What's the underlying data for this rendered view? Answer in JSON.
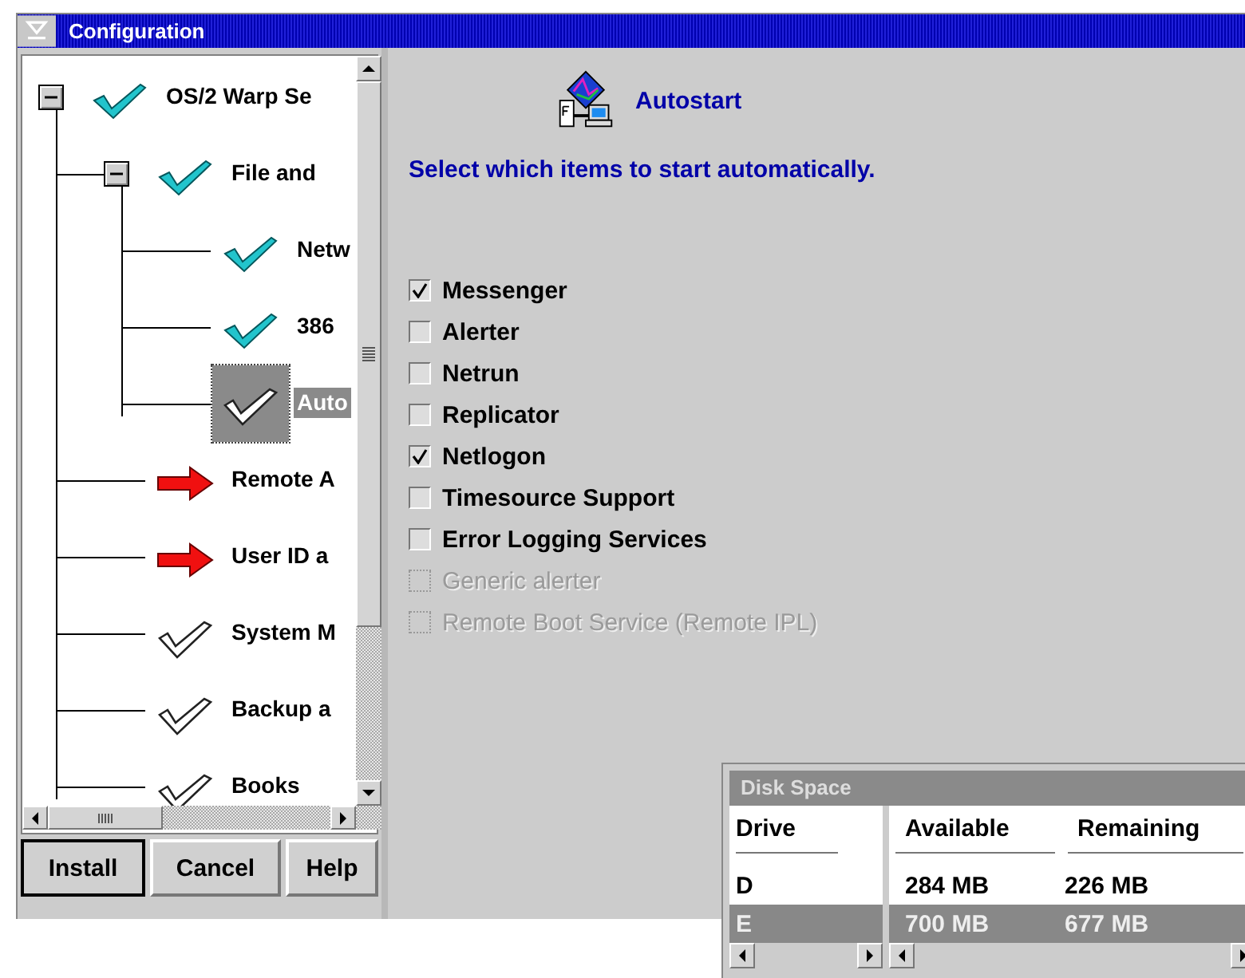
{
  "window": {
    "title": "Configuration"
  },
  "tree": [
    {
      "label": "OS/2 Warp Se",
      "kind": "check",
      "expanded": true,
      "selected": false,
      "children": [
        {
          "label": "File and",
          "kind": "check",
          "expanded": true,
          "selected": false,
          "children": [
            {
              "label": "Netw",
              "kind": "check",
              "selected": false
            },
            {
              "label": "386",
              "kind": "check",
              "selected": false
            },
            {
              "label": "Auto",
              "kind": "outline",
              "selected": true
            }
          ]
        },
        {
          "label": "Remote A",
          "kind": "arrow",
          "selected": false
        },
        {
          "label": "User ID a",
          "kind": "arrow",
          "selected": false
        },
        {
          "label": "System M",
          "kind": "outline",
          "selected": false
        },
        {
          "label": "Backup a",
          "kind": "outline",
          "selected": false
        },
        {
          "label": "Books",
          "kind": "outline",
          "selected": false
        }
      ]
    }
  ],
  "buttons": [
    {
      "label": "Install",
      "default": true
    },
    {
      "label": "Cancel",
      "default": false
    },
    {
      "label": "Help",
      "default": false
    }
  ],
  "page": {
    "title": "Autostart",
    "instruction": "Select which items to start automatically.",
    "items": [
      {
        "label": "Messenger",
        "checked": true,
        "disabled": false
      },
      {
        "label": "Alerter",
        "checked": false,
        "disabled": false
      },
      {
        "label": "Netrun",
        "checked": false,
        "disabled": false
      },
      {
        "label": "Replicator",
        "checked": false,
        "disabled": false
      },
      {
        "label": "Netlogon",
        "checked": true,
        "disabled": false
      },
      {
        "label": "Timesource Support",
        "checked": false,
        "disabled": false
      },
      {
        "label": "Error Logging Services",
        "checked": false,
        "disabled": false
      },
      {
        "label": "Generic alerter",
        "checked": false,
        "disabled": true
      },
      {
        "label": "Remote Boot Service (Remote IPL)",
        "checked": false,
        "disabled": true
      }
    ]
  },
  "disk_space": {
    "title": "Disk Space",
    "columns": [
      "Drive",
      "Available",
      "Remaining"
    ],
    "rows": [
      {
        "drive": "D",
        "available": "284 MB",
        "remaining": "226 MB",
        "selected": false
      },
      {
        "drive": "E",
        "available": "700 MB",
        "remaining": "677 MB",
        "selected": true
      }
    ]
  }
}
